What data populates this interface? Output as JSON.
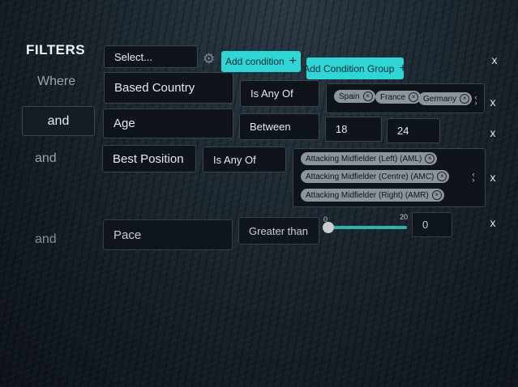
{
  "header": {
    "title": "FILTERS",
    "select_placeholder": "Select...",
    "add_condition_label": "Add condition",
    "add_group_label": "Add Condition Group",
    "close_label": "x"
  },
  "rows": [
    {
      "connector": "Where",
      "field": "Based Country",
      "operator": "Is Any Of",
      "chips": [
        "Spain",
        "France",
        "Germany"
      ],
      "close": "x"
    },
    {
      "connector": "and",
      "field": "Age",
      "operator": "Between",
      "min": "18",
      "max": "24",
      "close": "x"
    },
    {
      "connector": "and",
      "field": "Best Position",
      "operator": "Is Any Of",
      "chips": [
        "Attacking Midfielder (Left) (AML)",
        "Attacking Midfielder (Centre) (AMC)",
        "Attacking Midfielder (Right) (AMR)"
      ],
      "close": "x"
    },
    {
      "connector": "and",
      "field": "Pace",
      "operator": "Greater than",
      "slider": {
        "min_label": "0",
        "max_label": "20",
        "value": 0
      },
      "value": "0",
      "close": "x"
    }
  ],
  "icons": {
    "gear": "gear-icon",
    "chip_remove": "close-circle-icon",
    "stepper": "chevron-up-down-icon"
  },
  "chip_remove_glyph": "×",
  "colors": {
    "accent": "#2fd6d6",
    "slider": "#2fb3a8",
    "chip": "#8d959c"
  }
}
